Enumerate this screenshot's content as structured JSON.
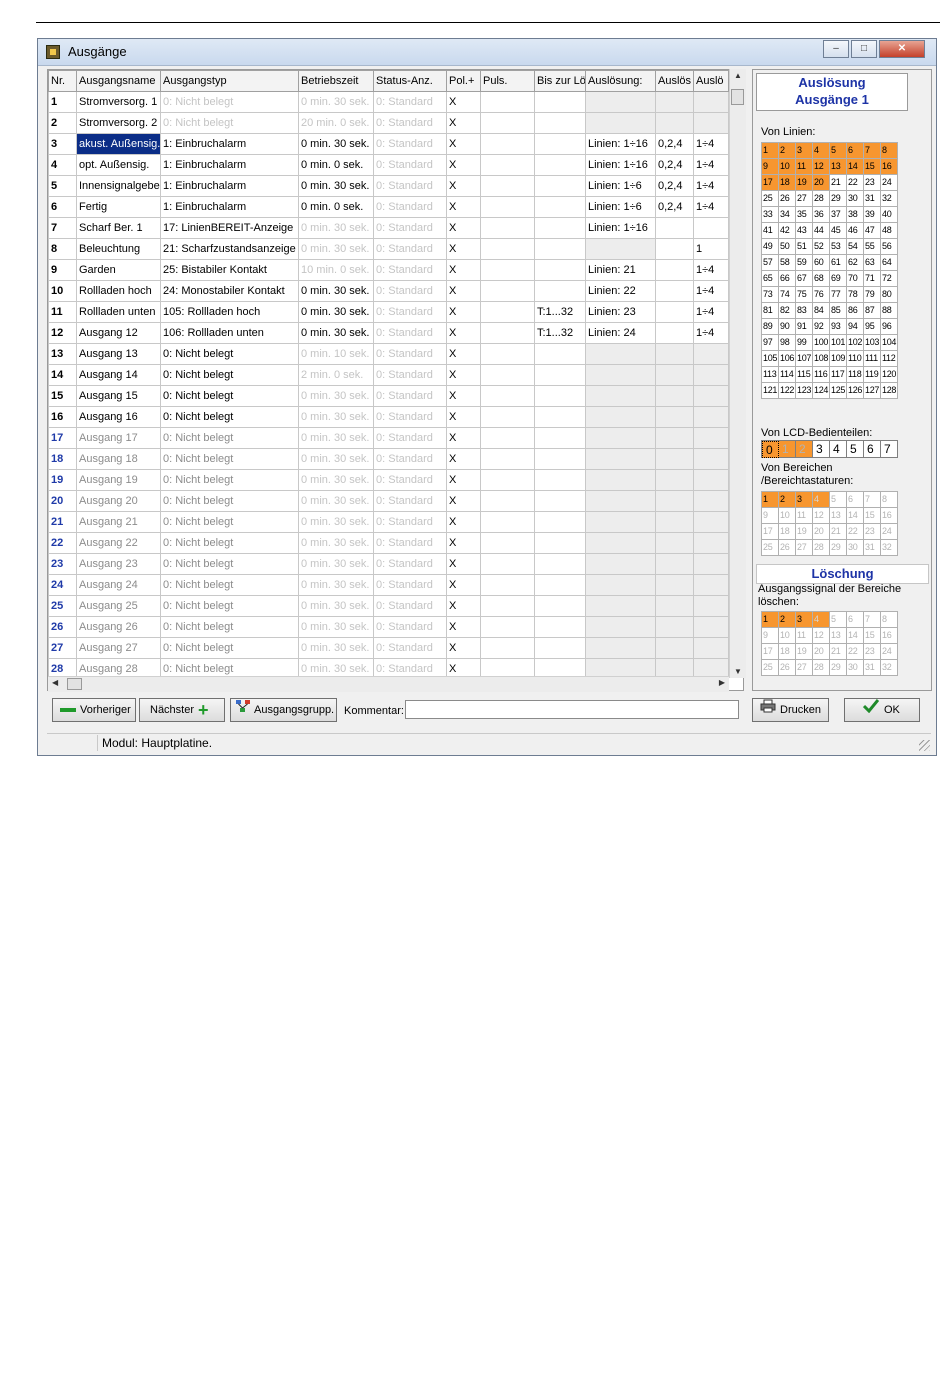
{
  "window": {
    "title": "Ausgänge",
    "minimize": "–",
    "maximize": "□",
    "close": "✕"
  },
  "columns": [
    "Nr.",
    "Ausgangsname",
    "Ausgangstyp",
    "Betriebszeit",
    "Status-Anz.",
    "Pol.+",
    "Puls.",
    "Bis zur Lö",
    "Auslösung:",
    "Auslös",
    "Auslö"
  ],
  "rows": [
    {
      "nr": "1",
      "name": "Stromversorg. 1",
      "type": "0: Nicht belegt",
      "time": "0  min. 30 sek.",
      "status": "0: Standard",
      "pol": "X",
      "puls": "",
      "bis": "",
      "ausl": "",
      "a1": "",
      "a2": ""
    },
    {
      "nr": "2",
      "name": "Stromversorg. 2",
      "type": "0: Nicht belegt",
      "time": "20 min. 0  sek.",
      "status": "0: Standard",
      "pol": "X",
      "puls": "",
      "bis": "",
      "ausl": "",
      "a1": "",
      "a2": ""
    },
    {
      "nr": "3",
      "name": "akust. Außensig.",
      "type": "1: Einbruchalarm",
      "time": "0  min. 30 sek.",
      "status": "0: Standard",
      "pol": "X",
      "puls": "",
      "bis": "",
      "ausl": "Linien: 1÷16",
      "a1": "0,2,4",
      "a2": "1÷4"
    },
    {
      "nr": "4",
      "name": "opt. Außensig.",
      "type": "1: Einbruchalarm",
      "time": "0  min. 0  sek.",
      "status": "0: Standard",
      "pol": "X",
      "puls": "",
      "bis": "",
      "ausl": "Linien: 1÷16",
      "a1": "0,2,4",
      "a2": "1÷4"
    },
    {
      "nr": "5",
      "name": "Innensignalgeber",
      "type": "1: Einbruchalarm",
      "time": "0  min. 30 sek.",
      "status": "0: Standard",
      "pol": "X",
      "puls": "",
      "bis": "",
      "ausl": "Linien: 1÷6",
      "a1": "0,2,4",
      "a2": "1÷4"
    },
    {
      "nr": "6",
      "name": "Fertig",
      "type": "1: Einbruchalarm",
      "time": "0  min. 0  sek.",
      "status": "0: Standard",
      "pol": "X",
      "puls": "",
      "bis": "",
      "ausl": "Linien: 1÷6",
      "a1": "0,2,4",
      "a2": "1÷4"
    },
    {
      "nr": "7",
      "name": "Scharf Ber. 1",
      "type": "17: LinienBEREIT-Anzeige",
      "time": "0  min. 30 sek.",
      "status": "0: Standard",
      "pol": "X",
      "puls": "",
      "bis": "",
      "ausl": "Linien: 1÷16",
      "a1": "",
      "a2": ""
    },
    {
      "nr": "8",
      "name": "Beleuchtung",
      "type": "21: Scharfzustandsanzeige",
      "time": "0  min. 30 sek.",
      "status": "0: Standard",
      "pol": "X",
      "puls": "",
      "bis": "",
      "ausl": "",
      "a1": "",
      "a2": "1"
    },
    {
      "nr": "9",
      "name": "Garden",
      "type": "25: Bistabiler Kontakt",
      "time": "10 min. 0  sek.",
      "status": "0: Standard",
      "pol": "X",
      "puls": "",
      "bis": "",
      "ausl": "Linien: 21",
      "a1": "",
      "a2": "1÷4"
    },
    {
      "nr": "10",
      "name": "Rollladen hoch",
      "type": "24: Monostabiler Kontakt",
      "time": "0  min. 30 sek.",
      "status": "0: Standard",
      "pol": "X",
      "puls": "",
      "bis": "",
      "ausl": "Linien: 22",
      "a1": "",
      "a2": "1÷4"
    },
    {
      "nr": "11",
      "name": "Rollladen unten",
      "type": "105: Rollladen hoch",
      "time": "0  min. 30 sek.",
      "status": "0: Standard",
      "pol": "X",
      "puls": "",
      "bis": "T:1...32",
      "ausl": "Linien: 23",
      "a1": "",
      "a2": "1÷4"
    },
    {
      "nr": "12",
      "name": "Ausgang 12",
      "type": "106: Rollladen unten",
      "time": "0  min. 30 sek.",
      "status": "0: Standard",
      "pol": "X",
      "puls": "",
      "bis": "T:1...32",
      "ausl": "Linien: 24",
      "a1": "",
      "a2": "1÷4"
    },
    {
      "nr": "13",
      "name": "Ausgang 13",
      "type": "0: Nicht belegt",
      "time": "0  min. 10 sek.",
      "status": "0: Standard",
      "pol": "X",
      "puls": "",
      "bis": "",
      "ausl": "",
      "a1": "",
      "a2": ""
    },
    {
      "nr": "14",
      "name": "Ausgang 14",
      "type": "0: Nicht belegt",
      "time": "2  min. 0  sek.",
      "status": "0: Standard",
      "pol": "X",
      "puls": "",
      "bis": "",
      "ausl": "",
      "a1": "",
      "a2": ""
    },
    {
      "nr": "15",
      "name": "Ausgang 15",
      "type": "0: Nicht belegt",
      "time": "0  min. 30 sek.",
      "status": "0: Standard",
      "pol": "X",
      "puls": "",
      "bis": "",
      "ausl": "",
      "a1": "",
      "a2": ""
    },
    {
      "nr": "16",
      "name": "Ausgang 16",
      "type": "0: Nicht belegt",
      "time": "0  min. 30 sek.",
      "status": "0: Standard",
      "pol": "X",
      "puls": "",
      "bis": "",
      "ausl": "",
      "a1": "",
      "a2": ""
    },
    {
      "nr": "17",
      "name": "Ausgang 17",
      "type": "0: Nicht belegt",
      "time": "0  min. 30 sek.",
      "status": "0: Standard",
      "pol": "X",
      "puls": "",
      "bis": "",
      "ausl": "",
      "a1": "",
      "a2": ""
    },
    {
      "nr": "18",
      "name": "Ausgang 18",
      "type": "0: Nicht belegt",
      "time": "0  min. 30 sek.",
      "status": "0: Standard",
      "pol": "X",
      "puls": "",
      "bis": "",
      "ausl": "",
      "a1": "",
      "a2": ""
    },
    {
      "nr": "19",
      "name": "Ausgang 19",
      "type": "0: Nicht belegt",
      "time": "0  min. 30 sek.",
      "status": "0: Standard",
      "pol": "X",
      "puls": "",
      "bis": "",
      "ausl": "",
      "a1": "",
      "a2": ""
    },
    {
      "nr": "20",
      "name": "Ausgang 20",
      "type": "0: Nicht belegt",
      "time": "0  min. 30 sek.",
      "status": "0: Standard",
      "pol": "X",
      "puls": "",
      "bis": "",
      "ausl": "",
      "a1": "",
      "a2": ""
    },
    {
      "nr": "21",
      "name": "Ausgang 21",
      "type": "0: Nicht belegt",
      "time": "0  min. 30 sek.",
      "status": "0: Standard",
      "pol": "X",
      "puls": "",
      "bis": "",
      "ausl": "",
      "a1": "",
      "a2": ""
    },
    {
      "nr": "22",
      "name": "Ausgang 22",
      "type": "0: Nicht belegt",
      "time": "0  min. 30 sek.",
      "status": "0: Standard",
      "pol": "X",
      "puls": "",
      "bis": "",
      "ausl": "",
      "a1": "",
      "a2": ""
    },
    {
      "nr": "23",
      "name": "Ausgang 23",
      "type": "0: Nicht belegt",
      "time": "0  min. 30 sek.",
      "status": "0: Standard",
      "pol": "X",
      "puls": "",
      "bis": "",
      "ausl": "",
      "a1": "",
      "a2": ""
    },
    {
      "nr": "24",
      "name": "Ausgang 24",
      "type": "0: Nicht belegt",
      "time": "0  min. 30 sek.",
      "status": "0: Standard",
      "pol": "X",
      "puls": "",
      "bis": "",
      "ausl": "",
      "a1": "",
      "a2": ""
    },
    {
      "nr": "25",
      "name": "Ausgang 25",
      "type": "0: Nicht belegt",
      "time": "0  min. 30 sek.",
      "status": "0: Standard",
      "pol": "X",
      "puls": "",
      "bis": "",
      "ausl": "",
      "a1": "",
      "a2": ""
    },
    {
      "nr": "26",
      "name": "Ausgang 26",
      "type": "0: Nicht belegt",
      "time": "0  min. 30 sek.",
      "status": "0: Standard",
      "pol": "X",
      "puls": "",
      "bis": "",
      "ausl": "",
      "a1": "",
      "a2": ""
    },
    {
      "nr": "27",
      "name": "Ausgang 27",
      "type": "0: Nicht belegt",
      "time": "0  min. 30 sek.",
      "status": "0: Standard",
      "pol": "X",
      "puls": "",
      "bis": "",
      "ausl": "",
      "a1": "",
      "a2": ""
    },
    {
      "nr": "28",
      "name": "Ausgang 28",
      "type": "0: Nicht belegt",
      "time": "0  min. 30 sek.",
      "status": "0: Standard",
      "pol": "X",
      "puls": "",
      "bis": "",
      "ausl": "",
      "a1": "",
      "a2": ""
    }
  ],
  "side": {
    "title_line1": "Auslösung",
    "title_line2": "Ausgänge 1",
    "lines_label": "Von Linien:",
    "lines_selected_count": 20,
    "lcd_label": "Von LCD-Bedienteilen:",
    "lcd": [
      "0",
      "1",
      "2",
      "3",
      "4",
      "5",
      "6",
      "7"
    ],
    "areas_label_1": "Von Bereichen",
    "areas_label_2": "/Bereichtastaturen:",
    "areas_selected": 3,
    "clear_title": "Löschung",
    "clear_label_1": "Ausgangssignal der Bereiche",
    "clear_label_2": "löschen:",
    "clear_selected": 3
  },
  "buttons": {
    "prev": "Vorheriger",
    "next": "Nächster",
    "groups": "Ausgangsgrupp.",
    "comment_label": "Kommentar:",
    "comment_value": "",
    "print": "Drucken",
    "ok": "OK"
  },
  "status": {
    "module": "Modul: Hauptplatine."
  },
  "colors": {
    "selected_cell": "#0b2d87",
    "orange": "#f7962f",
    "blue_text": "#1d33a6"
  }
}
